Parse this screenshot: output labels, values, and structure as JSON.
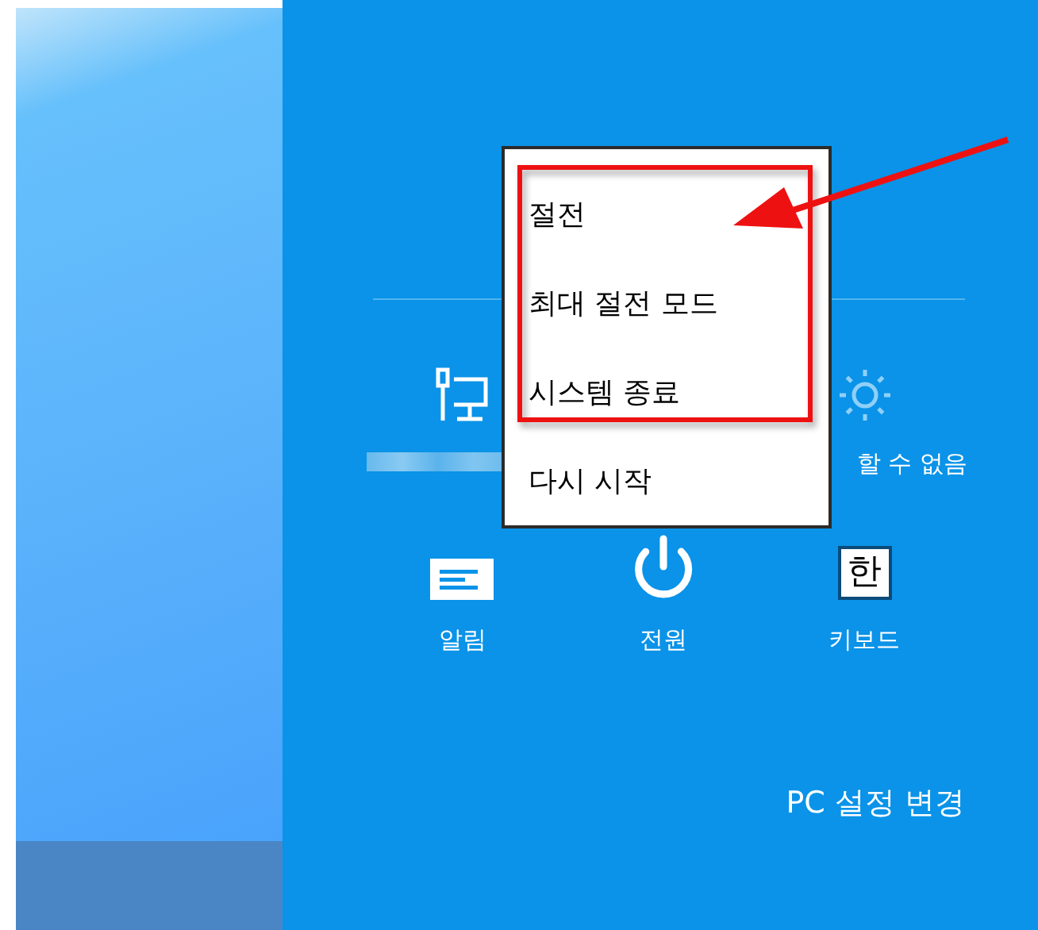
{
  "settings_panel": {
    "tiles": [
      {
        "kind": "network",
        "label_blurred": true
      },
      {
        "kind": "hidden"
      },
      {
        "kind": "brightness",
        "label": "할 수 없음"
      },
      {
        "kind": "notifications",
        "label": "알림"
      },
      {
        "kind": "power",
        "label": "전원"
      },
      {
        "kind": "keyboard",
        "glyph": "한",
        "label": "키보드"
      }
    ],
    "change_settings_link": "PC 설정 변경"
  },
  "power_menu": {
    "items": [
      {
        "label": "절전",
        "highlighted": true
      },
      {
        "label": "최대 절전 모드",
        "highlighted": true
      },
      {
        "label": "시스템 종료",
        "highlighted": true
      },
      {
        "label": "다시 시작",
        "highlighted": false
      }
    ]
  }
}
